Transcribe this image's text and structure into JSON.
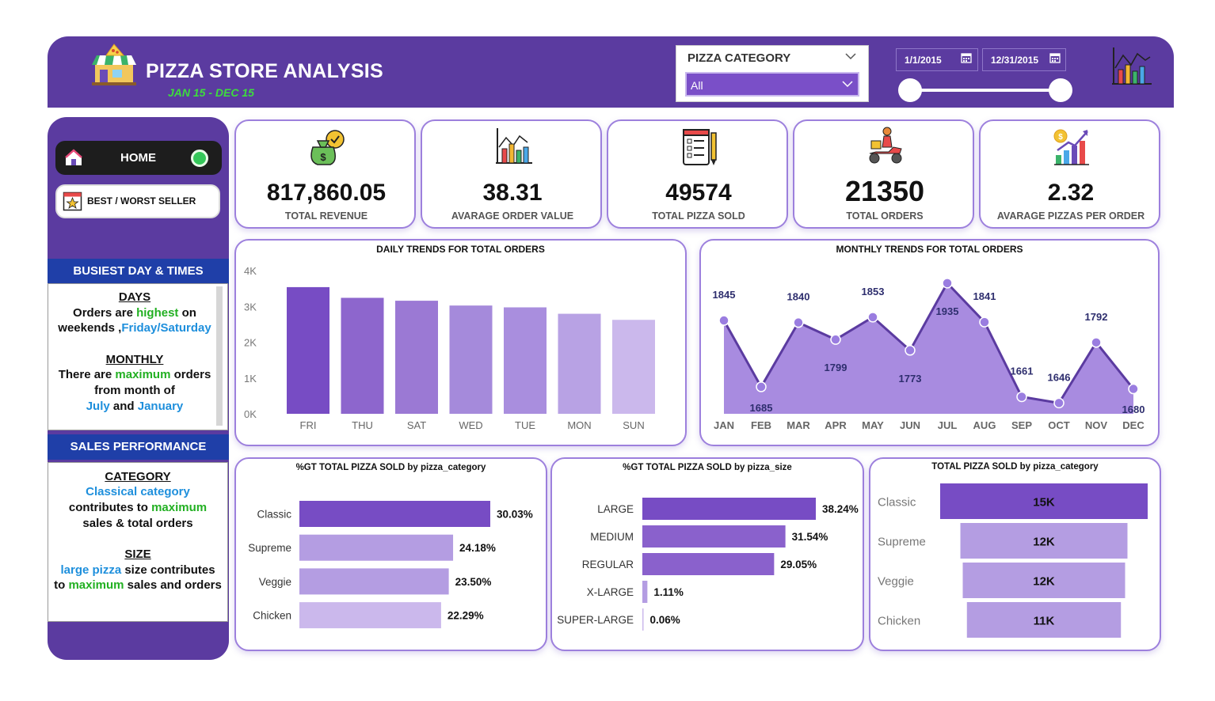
{
  "header": {
    "title": "PIZZA STORE ANALYSIS",
    "subtitle": "JAN 15 - DEC 15",
    "category_filter": {
      "label": "PIZZA CATEGORY",
      "selected": "All"
    },
    "date_start": "1/1/2015",
    "date_end": "12/31/2015"
  },
  "sidebar": {
    "home_label": "HOME",
    "best_worst_label": "BEST / WORST SELLER",
    "busiest_heading": "BUSIEST DAY & TIMES",
    "sales_heading": "SALES PERFORMANCE",
    "days_title": "DAYS",
    "days_line1_a": "Orders are ",
    "days_line1_b": "highest",
    "days_line1_c": " on",
    "days_line2_a": "weekends ,",
    "days_line2_b": "Friday/Saturday",
    "monthly_title": "MONTHLY",
    "monthly_line1_a": "There are ",
    "monthly_line1_b": "maximum",
    "monthly_line1_c": " orders",
    "monthly_line2": "from month of",
    "monthly_line3_a": "July",
    "monthly_line3_b": " and ",
    "monthly_line3_c": "January",
    "category_title": "CATEGORY",
    "category_line1": "Classical category",
    "category_line2_a": "contributes to ",
    "category_line2_b": "maximum",
    "category_line3": "sales & total orders",
    "size_title": "SIZE",
    "size_line1_a": "large pizza",
    "size_line1_b": " size contributes",
    "size_line2_a": "to ",
    "size_line2_b": "maximum",
    "size_line2_c": " sales and orders"
  },
  "kpis": [
    {
      "value": "817,860.05",
      "label": "TOTAL REVENUE",
      "icon": "money-bag-icon"
    },
    {
      "value": "38.31",
      "label": "AVARAGE ORDER VALUE",
      "icon": "bar-chart-icon"
    },
    {
      "value": "49574",
      "label": "TOTAL PIZZA SOLD",
      "icon": "checklist-icon"
    },
    {
      "value": "21350",
      "label": "TOTAL ORDERS",
      "icon": "delivery-scooter-icon"
    },
    {
      "value": "2.32",
      "label": "AVARAGE PIZZAS PER ORDER",
      "icon": "growth-chart-icon"
    }
  ],
  "colors": {
    "primary": "#5b3ba0",
    "accent": "#7a4fc8",
    "green": "#22b022",
    "blue": "#1e8fdc",
    "navy": "#1f3fa8"
  },
  "chart_data": [
    {
      "type": "bar",
      "title": "DAILY TRENDS FOR TOTAL ORDERS",
      "categories": [
        "FRI",
        "THU",
        "SAT",
        "WED",
        "TUE",
        "MON",
        "SUN"
      ],
      "values": [
        3538,
        3239,
        3158,
        3024,
        2973,
        2794,
        2624
      ],
      "yticks": [
        "0K",
        "1K",
        "2K",
        "3K",
        "4K"
      ],
      "ylim": [
        0,
        4000
      ],
      "colors": [
        "#774cc4",
        "#8d66cd",
        "#9b79d4",
        "#a58adb",
        "#a98ede",
        "#b8a2e4",
        "#cbb8ec"
      ]
    },
    {
      "type": "area",
      "title": "MONTHLY TRENDS FOR TOTAL ORDERS",
      "categories": [
        "JAN",
        "FEB",
        "MAR",
        "APR",
        "MAY",
        "JUN",
        "JUL",
        "AUG",
        "SEP",
        "OCT",
        "NOV",
        "DEC"
      ],
      "values": [
        1845,
        1685,
        1840,
        1799,
        1853,
        1773,
        1935,
        1841,
        1661,
        1646,
        1792,
        1680
      ],
      "labels": [
        "1845",
        "1685",
        "1840",
        "1799",
        "1853",
        "1773",
        "1935",
        "1841",
        "1661",
        "1646",
        "1792",
        "1680"
      ],
      "ylim": [
        1620,
        1950
      ]
    },
    {
      "type": "bar",
      "orientation": "horizontal",
      "title": "%GT TOTAL PIZZA SOLD by pizza_category",
      "categories": [
        "Classic",
        "Supreme",
        "Veggie",
        "Chicken"
      ],
      "values": [
        30.03,
        24.18,
        23.5,
        22.29
      ],
      "labels": [
        "30.03%",
        "24.18%",
        "23.50%",
        "22.29%"
      ],
      "colors": [
        "#774cc4",
        "#b49de2",
        "#b49de2",
        "#cbb8ec"
      ]
    },
    {
      "type": "bar",
      "orientation": "horizontal",
      "title": "%GT TOTAL PIZZA SOLD by pizza_size",
      "categories": [
        "LARGE",
        "MEDIUM",
        "REGULAR",
        "X-LARGE",
        "SUPER-LARGE"
      ],
      "values": [
        38.24,
        31.54,
        29.05,
        1.11,
        0.06
      ],
      "labels": [
        "38.24%",
        "31.54%",
        "29.05%",
        "1.11%",
        "0.06%"
      ],
      "colors": [
        "#774cc4",
        "#8a61cc",
        "#8a61cc",
        "#b49de2",
        "#cbb8ec"
      ]
    },
    {
      "type": "bar",
      "orientation": "horizontal",
      "title": "TOTAL PIZZA SOLD by pizza_category",
      "categories": [
        "Classic",
        "Supreme",
        "Veggie",
        "Chicken"
      ],
      "values": [
        14888,
        11987,
        11649,
        11050
      ],
      "labels": [
        "15K",
        "12K",
        "12K",
        "11K"
      ],
      "colors": [
        "#774cc4",
        "#b49de2",
        "#b49de2",
        "#b49de2"
      ]
    }
  ]
}
